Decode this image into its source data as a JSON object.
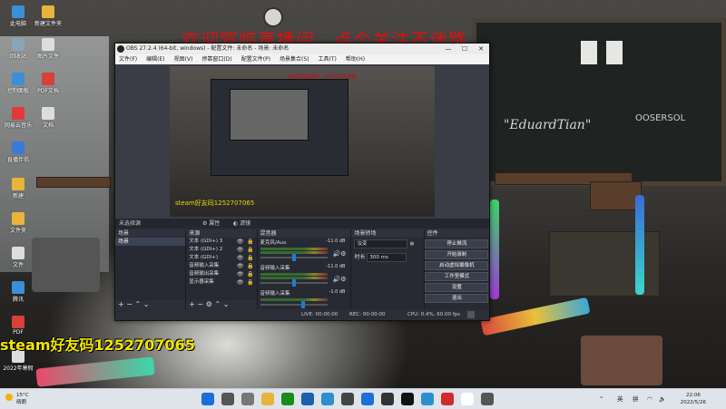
{
  "desktop": {
    "banner": "欢迎驾临直播间，点个关注不迷路",
    "steam_overlay": "steam好友码1252707065",
    "chalk_text": "\"EduardTian\"",
    "chalk_text_right": "OOSERSOL",
    "icons": [
      {
        "label": "此电脑",
        "color": "#3a8fd8"
      },
      {
        "label": "新建文件夹",
        "color": "#e8b43a"
      },
      {
        "label": "回收站",
        "color": "#8aa4b8"
      },
      {
        "label": "图片文件",
        "color": "#dddddd"
      },
      {
        "label": "控制面板",
        "color": "#3a8fd8"
      },
      {
        "label": "PDF文档",
        "color": "#d8403a"
      },
      {
        "label": "网易云音乐",
        "color": "#e03a3a"
      },
      {
        "label": "文档",
        "color": "#dddddd"
      },
      {
        "label": "直播伴侣",
        "color": "#3a7ad8"
      },
      {
        "label": "文档(1)",
        "color": "#d8403a"
      },
      {
        "label": "新建",
        "color": "#e8b43a"
      },
      {
        "label": "WPS",
        "color": "#3a6ad8"
      },
      {
        "label": "文件夹",
        "color": "#e8b43a"
      },
      {
        "label": "文件",
        "color": "#dddddd"
      },
      {
        "label": "腾讯",
        "color": "#3a8fd8"
      },
      {
        "label": "文档2",
        "color": "#dddddd"
      },
      {
        "label": "PDF",
        "color": "#d8403a"
      },
      {
        "label": "2022年寒假",
        "color": "#dddddd"
      }
    ]
  },
  "obs": {
    "title": "OBS 27.2.4 (64-bit, windows) - 配置文件: 未命名 - 场景: 未命名",
    "menu": [
      "文件(F)",
      "编辑(E)",
      "视图(V)",
      "停靠窗口(D)",
      "配置文件(P)",
      "场景集合(S)",
      "工具(T)",
      "帮助(H)"
    ],
    "canvas_steam": "steam好友码1252707065",
    "canvas_red": "欢迎驾临直播间，点个关注不迷路",
    "source_bar": {
      "left": "未选择源",
      "props": "属性",
      "filters": "滤镜"
    },
    "scenes": {
      "title": "场景",
      "items": [
        "场景"
      ]
    },
    "sources": {
      "title": "来源",
      "items": [
        "文本 (GDI+) 3",
        "文本 (GDI+) 2",
        "文本 (GDI+)",
        "音频输入采集",
        "音频输出采集",
        "显示器采集"
      ]
    },
    "mixer": {
      "title": "混音器",
      "rows": [
        {
          "name": "麦克风/Aux",
          "db": "-11.0 dB",
          "fader": 0.48
        },
        {
          "name": "音频输入采集",
          "db": "-11.0 dB",
          "fader": 0.48
        },
        {
          "name": "音频输入采集",
          "db": "-1.0 dB",
          "fader": 0.62
        }
      ]
    },
    "transitions": {
      "title": "场景转场",
      "type": "淡变",
      "duration_label": "时长",
      "duration": "300 ms"
    },
    "controls": {
      "title": "控件",
      "buttons": [
        "停止推流",
        "开始录制",
        "启动虚拟摄像机",
        "工作室模式",
        "设置",
        "退出"
      ]
    },
    "status": {
      "live": "LIVE: 00:00:00",
      "rec": "REC: 00:00:00",
      "cpu": "CPU: 0.4%, 60.00 fps"
    }
  },
  "taskbar": {
    "weather_temp": "15°C",
    "weather_desc": "晴朗",
    "time": "22:06",
    "date": "2022/5/26",
    "lang1": "英",
    "lang2": "拼",
    "app_colors": [
      "#1c6fd8",
      "#555555",
      "#777777",
      "#e8b43a",
      "#1a8c1a",
      "#1a5fb0",
      "#2a8fd0",
      "#444444",
      "#1c6fd8",
      "#333333",
      "#111111",
      "#2a8fd0",
      "#d02a2a",
      "#ffffff",
      "#555555"
    ]
  }
}
